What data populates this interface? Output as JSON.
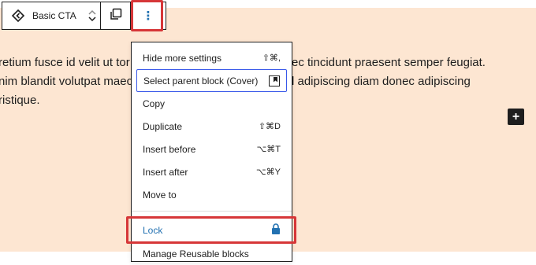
{
  "colors": {
    "canvas_bg": "#fde6d2",
    "highlight": "#d63638",
    "accent_blue": "#2271b1",
    "focus_blue": "#3858e9"
  },
  "paragraph": {
    "lines": [
      {
        "left": "retium fusce id velit ut tor",
        "right": "ec tincidunt praesent semper feugiat."
      },
      {
        "left": "nim blandit volutpat maec",
        "right": "l adipiscing diam donec adipiscing"
      },
      {
        "left": "ristique.",
        "right": ""
      }
    ]
  },
  "toolbar": {
    "block_icon": "cta-diamond-arrows-icon",
    "block_name": "Basic CTA",
    "move_up_icon": "chevron-up-icon",
    "move_down_icon": "chevron-down-icon",
    "duplicate_icon": "duplicate-icon",
    "more_options_icon": "vertical-ellipsis-icon",
    "more_options_glyph": "⋮"
  },
  "inserter": {
    "icon": "plus-icon",
    "glyph": "+"
  },
  "menu": {
    "items": [
      {
        "label": "Hide more settings",
        "shortcut": "⇧⌘,",
        "selected": false
      },
      {
        "label": "Select parent block (Cover)",
        "shortcut": "",
        "icon": "cover-block-icon",
        "selected": true
      },
      {
        "label": "Copy",
        "shortcut": ""
      },
      {
        "label": "Duplicate",
        "shortcut": "⇧⌘D"
      },
      {
        "label": "Insert before",
        "shortcut": "⌥⌘T"
      },
      {
        "label": "Insert after",
        "shortcut": "⌥⌘Y"
      },
      {
        "label": "Move to",
        "shortcut": ""
      },
      {
        "label": "Lock",
        "shortcut": "",
        "icon": "lock-icon"
      },
      {
        "label": "Manage Reusable blocks",
        "shortcut": ""
      }
    ]
  }
}
